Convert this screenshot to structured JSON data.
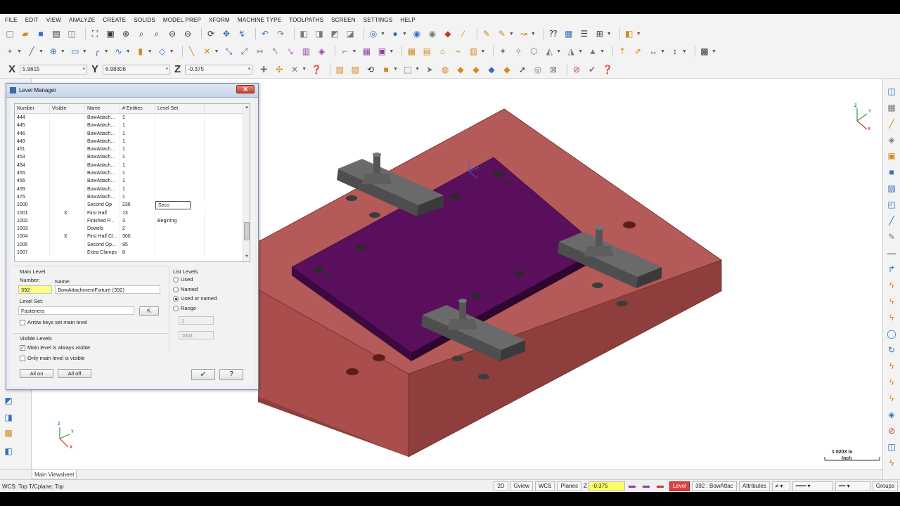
{
  "menu": [
    "FILE",
    "EDIT",
    "VIEW",
    "ANALYZE",
    "CREATE",
    "SOLIDS",
    "MODEL PREP",
    "XFORM",
    "MACHINE TYPE",
    "TOOLPATHS",
    "SCREEN",
    "SETTINGS",
    "HELP"
  ],
  "coords": {
    "x_label": "X",
    "x_value": "5.9615",
    "y_label": "Y",
    "y_value": "6.98306",
    "z_label": "Z",
    "z_value": "-0.375"
  },
  "dialog": {
    "title": "Level Manager",
    "close_label": "✕",
    "columns": [
      "Number",
      "Visible",
      "Name",
      "# Entities",
      "Level Set"
    ],
    "rows": [
      {
        "number": "444",
        "visible": "",
        "name": "BowAttach...",
        "entities": "1",
        "level_set": ""
      },
      {
        "number": "445",
        "visible": "",
        "name": "BowAttach...",
        "entities": "1",
        "level_set": ""
      },
      {
        "number": "446",
        "visible": "",
        "name": "BowAttach...",
        "entities": "1",
        "level_set": ""
      },
      {
        "number": "449",
        "visible": "",
        "name": "BowAttach...",
        "entities": "1",
        "level_set": ""
      },
      {
        "number": "451",
        "visible": "",
        "name": "BowAttach...",
        "entities": "1",
        "level_set": ""
      },
      {
        "number": "453",
        "visible": "",
        "name": "BowAttach...",
        "entities": "1",
        "level_set": ""
      },
      {
        "number": "454",
        "visible": "",
        "name": "BowAttach...",
        "entities": "1",
        "level_set": ""
      },
      {
        "number": "455",
        "visible": "",
        "name": "BowAttach...",
        "entities": "1",
        "level_set": ""
      },
      {
        "number": "456",
        "visible": "",
        "name": "BowAttach...",
        "entities": "1",
        "level_set": ""
      },
      {
        "number": "459",
        "visible": "",
        "name": "BowAttach...",
        "entities": "1",
        "level_set": ""
      },
      {
        "number": "475",
        "visible": "",
        "name": "BowAttach...",
        "entities": "1",
        "level_set": ""
      },
      {
        "number": "1000",
        "visible": "",
        "name": "Second Op",
        "entities": "236",
        "level_set": "Seco"
      },
      {
        "number": "1001",
        "visible": "X",
        "name": "First Half",
        "entities": "13",
        "level_set": ""
      },
      {
        "number": "1002",
        "visible": "",
        "name": "Finished P...",
        "entities": "3",
        "level_set": "Begining"
      },
      {
        "number": "1003",
        "visible": "",
        "name": "Dowels",
        "entities": "2",
        "level_set": ""
      },
      {
        "number": "1004",
        "visible": "X",
        "name": "First Half Cl...",
        "entities": "300",
        "level_set": ""
      },
      {
        "number": "1005",
        "visible": "",
        "name": "Second Op...",
        "entities": "95",
        "level_set": ""
      },
      {
        "number": "1007",
        "visible": "",
        "name": "Extra Clamps",
        "entities": "8",
        "level_set": ""
      }
    ],
    "main_level": {
      "group_label": "Main Level",
      "number_label": "Number:",
      "number_value": "392",
      "name_label": "Name:",
      "name_value": "BowAttachmentFixture (392)",
      "level_set_label": "Level Set:",
      "level_set_value": "Fasteners",
      "arrow_keys_label": "Arrow keys set main level"
    },
    "list_levels": {
      "group_label": "List Levels",
      "used": "Used",
      "named": "Named",
      "used_or_named": "Used or named",
      "range": "Range",
      "range_from": "1",
      "range_to": "1001"
    },
    "visible_levels": {
      "group_label": "Visible Levels",
      "always_visible": "Main level is always visible",
      "only_main": "Only main level is visible",
      "all_on": "All on",
      "all_off": "All off"
    },
    "ok_label": "✔",
    "help_label": "?"
  },
  "viewport": {
    "scale_value": "1.0203 in",
    "scale_unit": "Inch",
    "axis_x": "X",
    "axis_y": "Y",
    "axis_z": "Z"
  },
  "tab": {
    "label": "Main Viewsheet"
  },
  "status": {
    "left": "WCS: Top  T/Cplane: Top",
    "btn_2d": "2D",
    "gview": "Gview",
    "wcs": "WCS",
    "planes": "Planes",
    "z_label": "Z",
    "z_value": "-0.375",
    "level_label": "Level",
    "level_value": "392 : BowAttac",
    "attributes": "Attributes",
    "groups": "Groups"
  },
  "colors": {
    "base_plate": "#b45a58",
    "base_side": "#8e3e3c",
    "purple_plate": "#5a0f5c",
    "clamp": "#4e4e4e"
  }
}
